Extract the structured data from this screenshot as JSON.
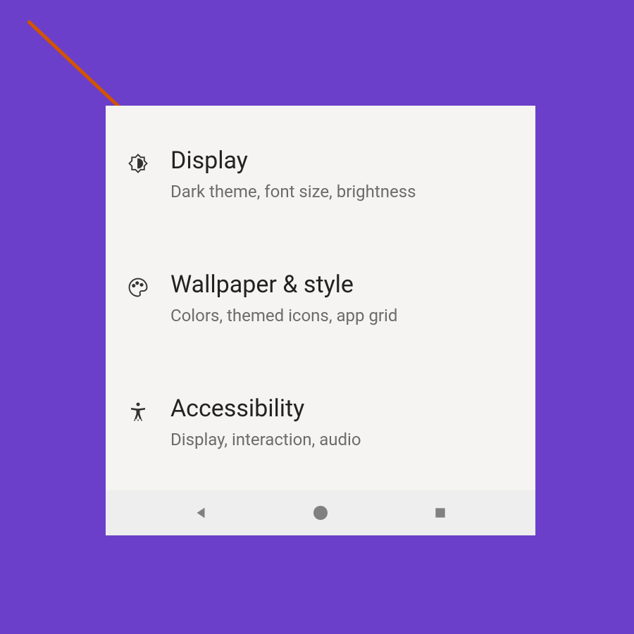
{
  "settings": {
    "items": [
      {
        "title": "Display",
        "subtitle": "Dark theme, font size, brightness",
        "icon": "brightness-icon"
      },
      {
        "title": "Wallpaper & style",
        "subtitle": "Colors, themed icons, app grid",
        "icon": "palette-icon"
      },
      {
        "title": "Accessibility",
        "subtitle": "Display, interaction, audio",
        "icon": "accessibility-icon"
      }
    ]
  },
  "annotation": {
    "arrow_color": "#d35400"
  },
  "colors": {
    "background": "#6b3fc9",
    "panel": "#f5f4f2",
    "navbar": "#eeeeee",
    "title_text": "#222222",
    "subtitle_text": "#6b6b6b",
    "nav_icon": "#808080"
  }
}
